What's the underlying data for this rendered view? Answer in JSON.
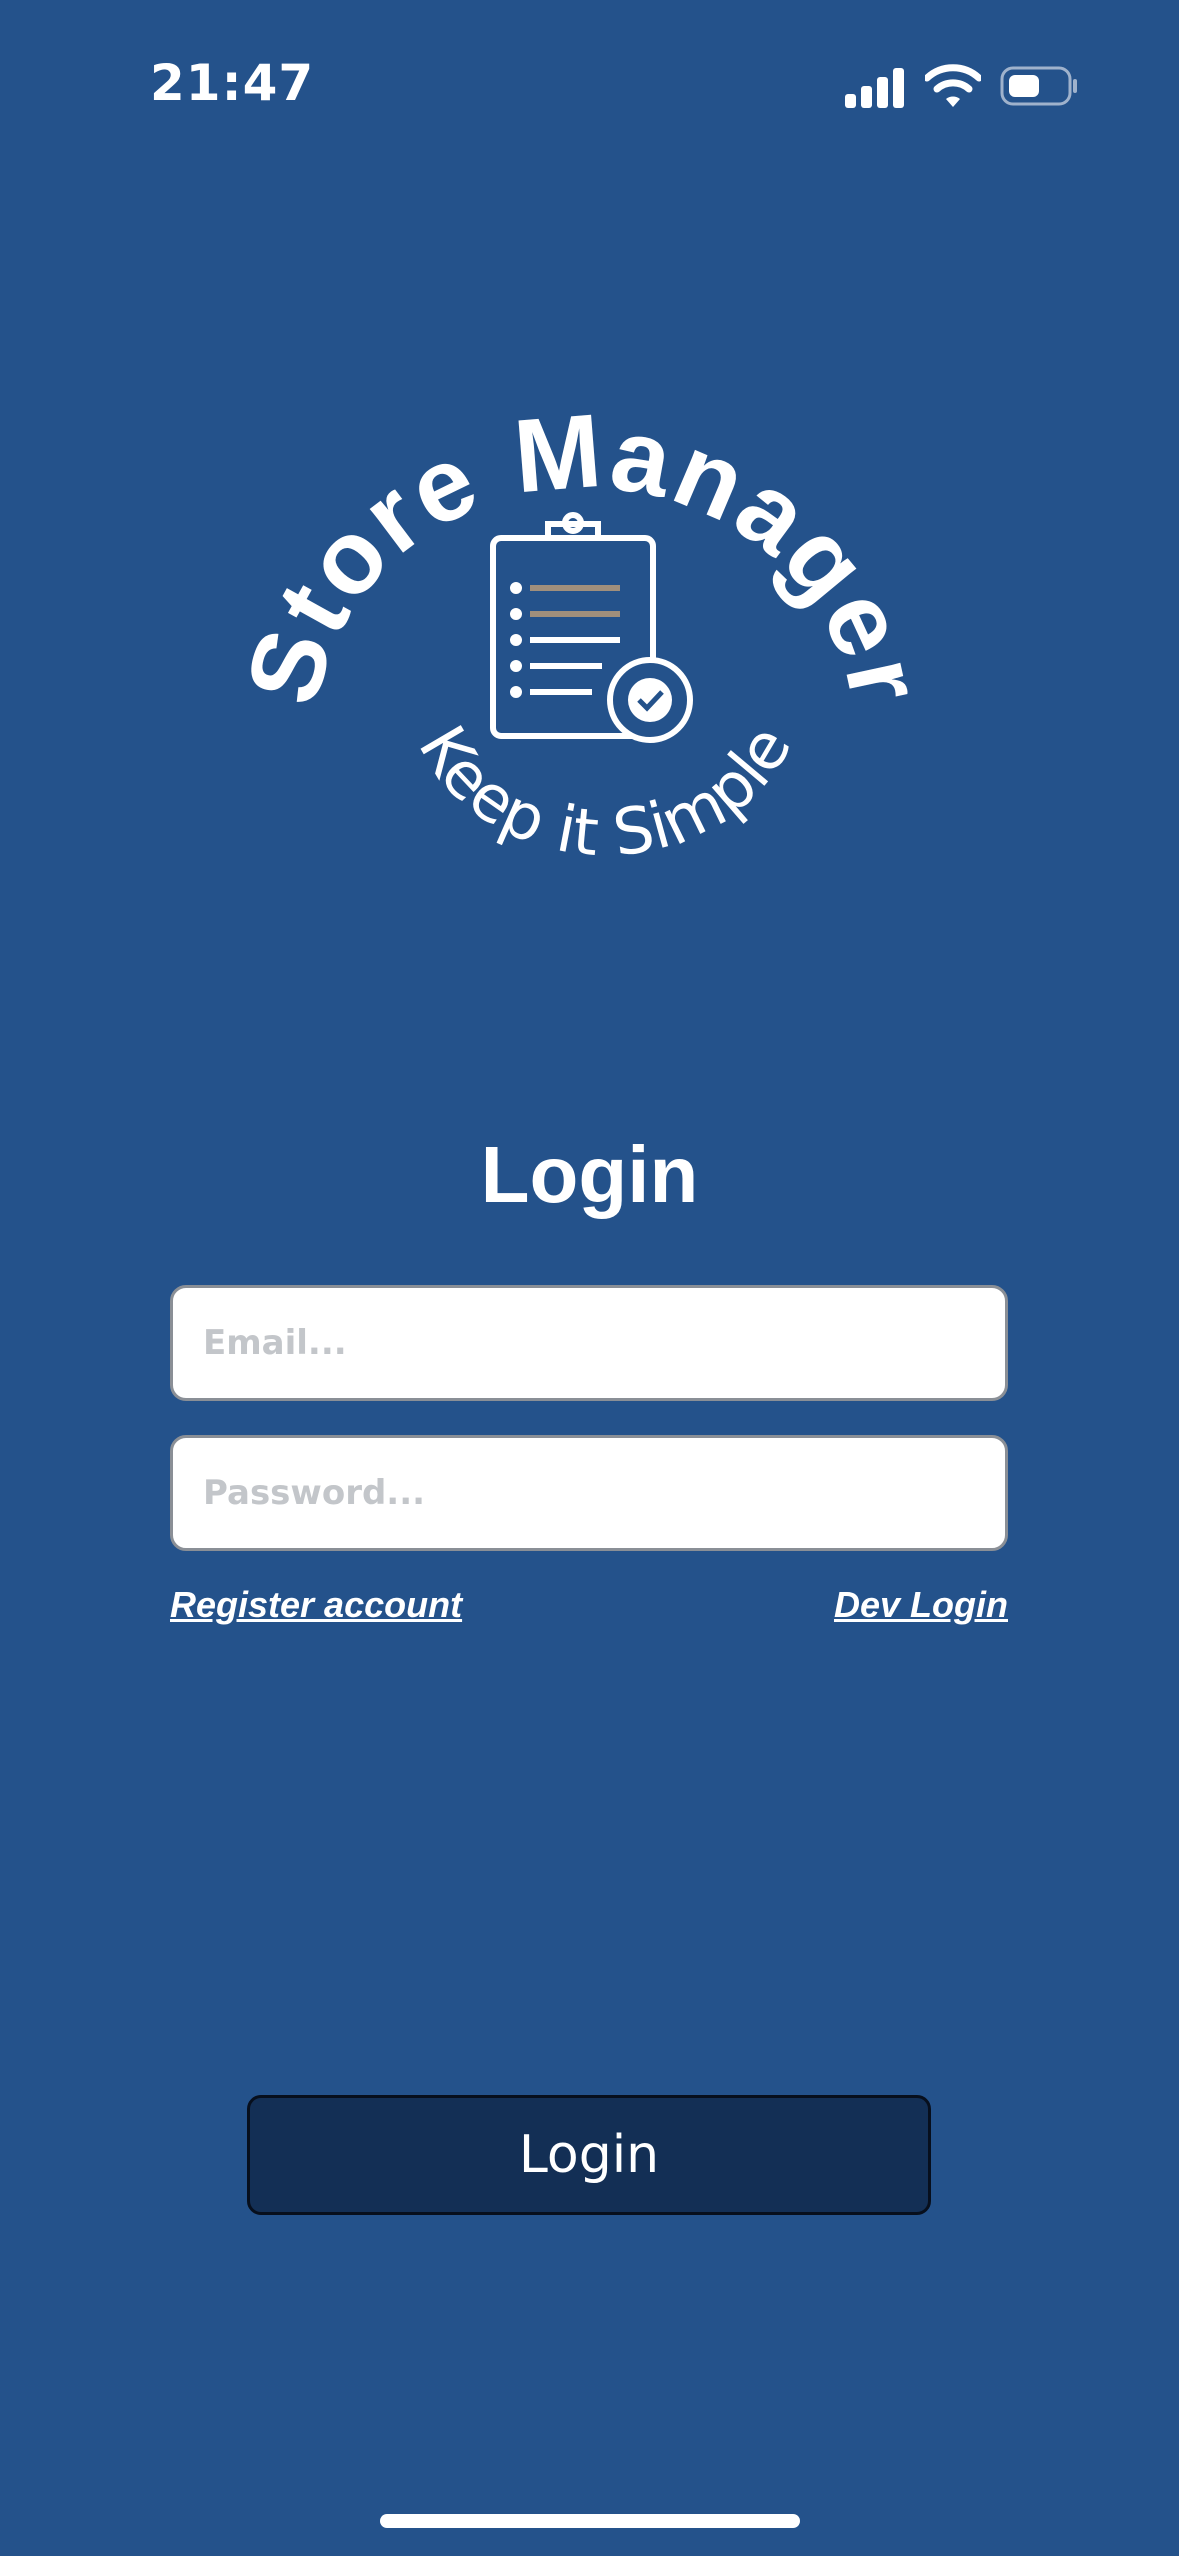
{
  "status_bar": {
    "time": "21:47"
  },
  "logo": {
    "brand": "Store Manager",
    "tagline": "Keep it Simple",
    "icon": "clipboard-check-icon"
  },
  "login": {
    "title": "Login",
    "email_placeholder": "Email...",
    "password_placeholder": "Password...",
    "register_link": "Register account",
    "dev_link": "Dev Login",
    "submit_label": "Login"
  },
  "colors": {
    "background": "#24528b",
    "button": "#132f55"
  }
}
